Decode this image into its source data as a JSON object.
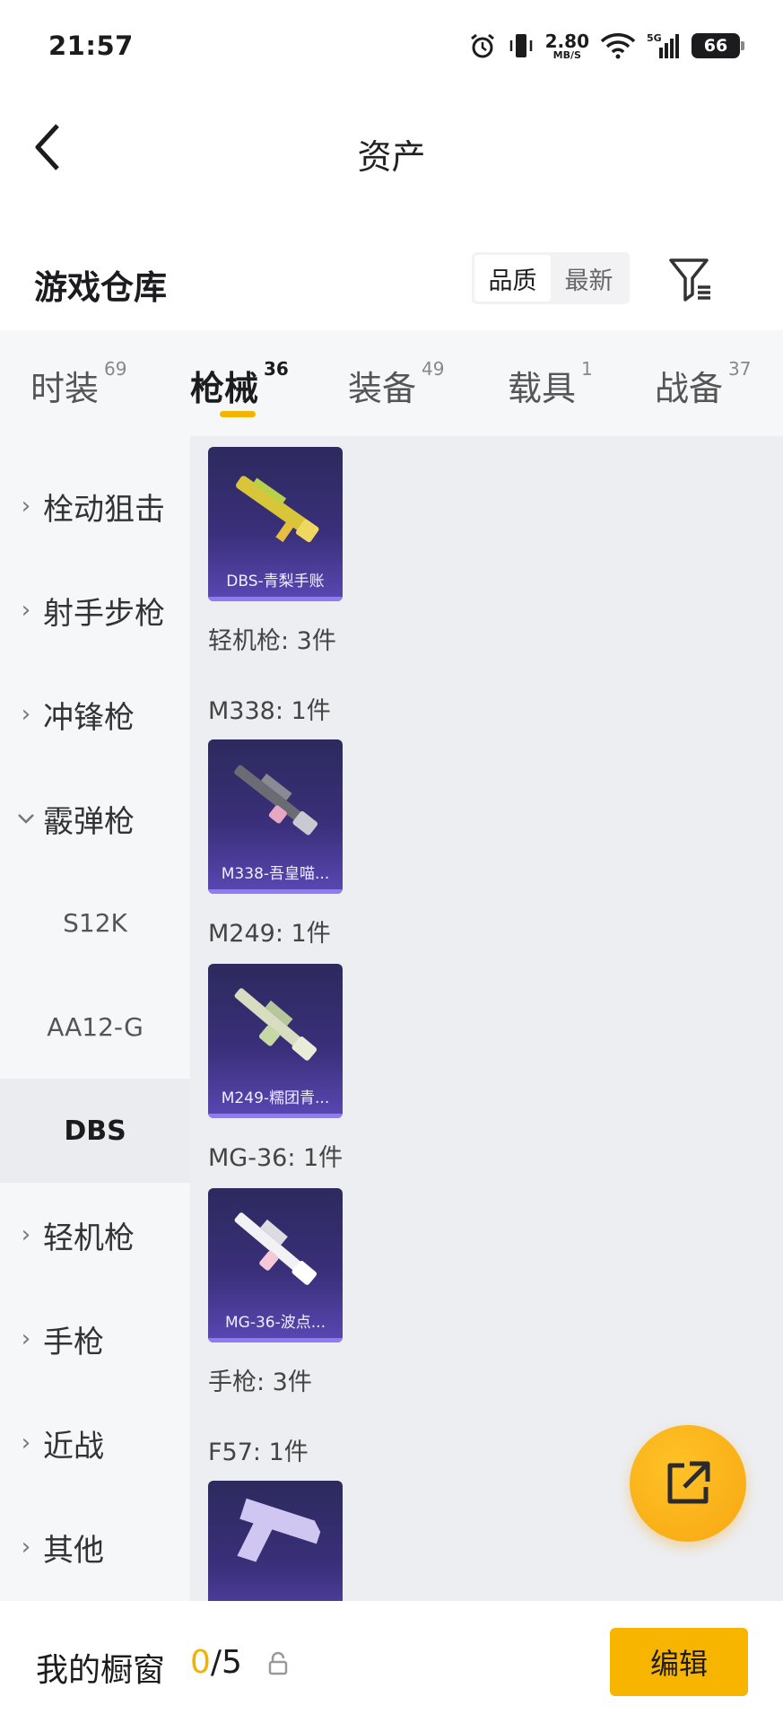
{
  "status_bar": {
    "time": "21:57",
    "net_speed_value": "2.80",
    "net_speed_unit": "MB/S",
    "network": "5G",
    "battery": "66",
    "icons": [
      "alarm-icon",
      "vibrate-icon",
      "wifi-icon",
      "signal-icon",
      "battery-icon"
    ]
  },
  "header": {
    "title": "资产"
  },
  "warehouse": {
    "title": "游戏仓库",
    "sort_options": [
      {
        "label": "品质",
        "active": true
      },
      {
        "label": "最新",
        "active": false
      }
    ]
  },
  "tabs": [
    {
      "label": "时装",
      "count": "69",
      "active": false
    },
    {
      "label": "枪械",
      "count": "36",
      "active": true
    },
    {
      "label": "装备",
      "count": "49",
      "active": false
    },
    {
      "label": "载具",
      "count": "1",
      "active": false
    },
    {
      "label": "战备",
      "count": "37",
      "active": false
    }
  ],
  "sidebar": {
    "categories": [
      {
        "label": "栓动狙击",
        "expanded": false
      },
      {
        "label": "射手步枪",
        "expanded": false
      },
      {
        "label": "冲锋枪",
        "expanded": false
      },
      {
        "label": "霰弹枪",
        "expanded": true
      },
      {
        "label": "轻机枪",
        "expanded": false
      },
      {
        "label": "手枪",
        "expanded": false
      },
      {
        "label": "近战",
        "expanded": false
      },
      {
        "label": "其他",
        "expanded": false
      }
    ],
    "subitems": [
      {
        "label": "S12K",
        "selected": false
      },
      {
        "label": "AA12-G",
        "selected": false
      },
      {
        "label": "DBS",
        "selected": true
      }
    ]
  },
  "items": {
    "dbs_card": "DBS-青梨手账",
    "lmg_group": "轻机枪: 3件",
    "m338_label": "M338: 1件",
    "m338_card": "M338-吾皇喵...",
    "m249_label": "M249: 1件",
    "m249_card": "M249-糯团青...",
    "mg36_label": "MG-36: 1件",
    "mg36_card": "MG-36-波点...",
    "pistol_group": "手枪: 3件",
    "f57_label": "F57: 1件"
  },
  "bottom_bar": {
    "label": "我的橱窗",
    "current": "0",
    "total": "/5",
    "edit_label": "编辑"
  },
  "colors": {
    "accent": "#f7b500",
    "card_bg": "#3a2f7a",
    "card_border": "#8f7cf2"
  }
}
